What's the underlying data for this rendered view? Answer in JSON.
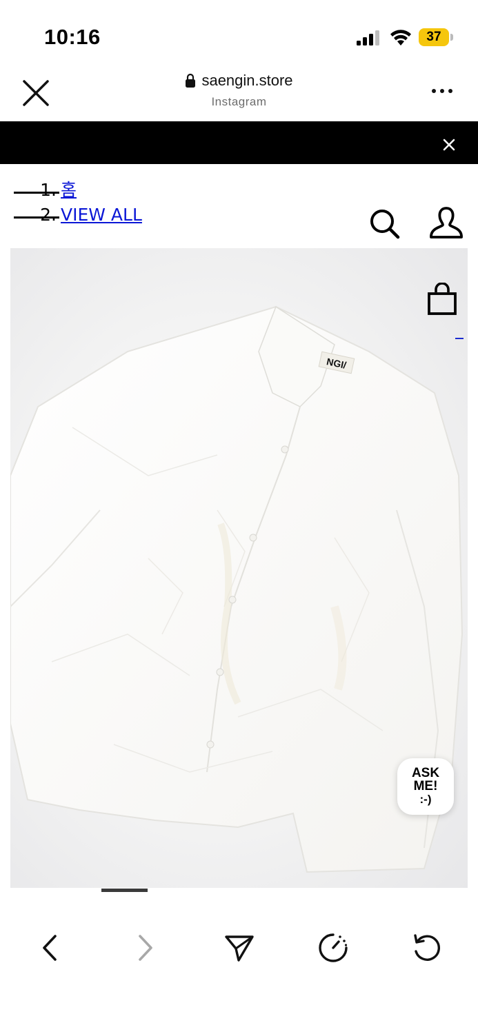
{
  "status_bar": {
    "time": "10:16",
    "battery_level": "37"
  },
  "browser": {
    "url": "saengin.store",
    "source": "Instagram"
  },
  "breadcrumb": [
    {
      "num": "1.",
      "label": "홈"
    },
    {
      "num": "2.",
      "label": "VIEW ALL"
    }
  ],
  "product": {
    "tag_text": "NGI/"
  },
  "ask_widget": {
    "line1": "ASK",
    "line2": "ME!",
    "line3": ":-)"
  },
  "icons": {
    "close": "close-icon",
    "lock": "lock-icon",
    "more": "more-icon",
    "banner_close": "close-icon",
    "search": "search-icon",
    "user": "user-icon",
    "bag": "shopping-bag-icon",
    "back": "chevron-left-icon",
    "forward": "chevron-right-icon",
    "share": "send-icon",
    "speed": "speedometer-icon",
    "reload": "reload-icon"
  },
  "colors": {
    "link": "#0b17d6",
    "banner": "#000000",
    "battery": "#f5c60d"
  }
}
